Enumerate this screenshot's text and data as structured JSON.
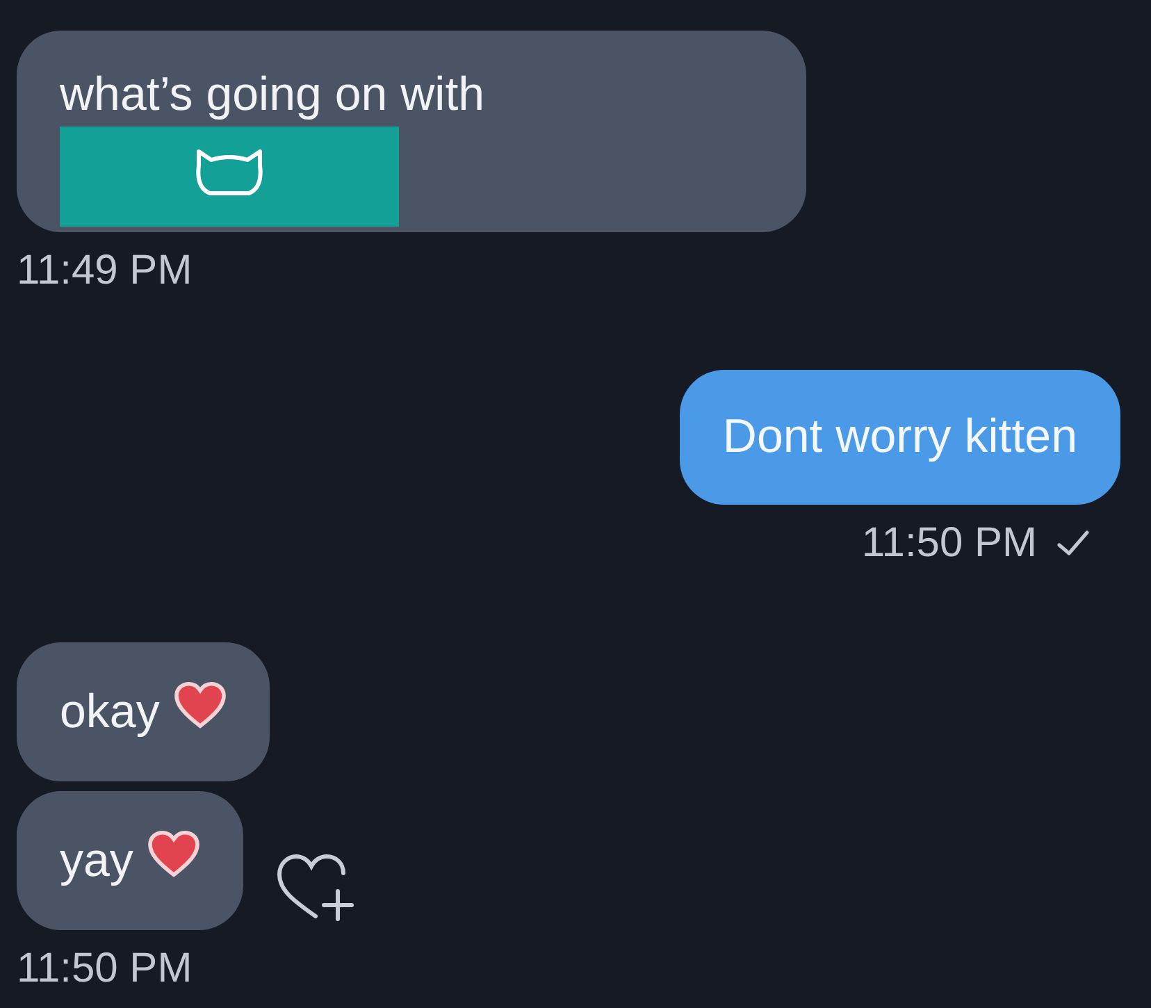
{
  "items": [
    {
      "kind": "received",
      "text": "what’s going on with",
      "redacted": true,
      "heart": false,
      "react_button": false
    },
    {
      "kind": "time",
      "text": "11:49 PM",
      "read": false
    },
    {
      "kind": "sent",
      "text": "Dont worry kitten",
      "redacted": false,
      "heart": false,
      "react_button": false
    },
    {
      "kind": "time",
      "text": "11:50 PM",
      "read": true
    },
    {
      "kind": "received",
      "text": "okay",
      "redacted": false,
      "heart": true,
      "react_button": false
    },
    {
      "kind": "received",
      "text": "yay",
      "redacted": false,
      "heart": true,
      "react_button": true
    },
    {
      "kind": "time",
      "text": "11:50 PM",
      "read": false
    }
  ]
}
